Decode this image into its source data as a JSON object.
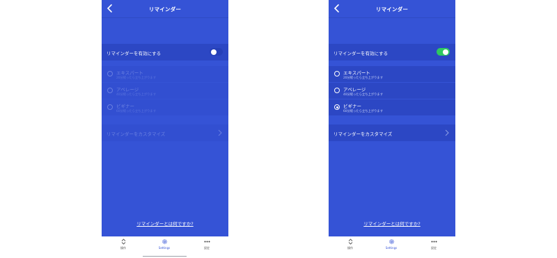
{
  "header": {
    "title": "リマインダー"
  },
  "toggle_row": {
    "label": "リマインダーを有効にする"
  },
  "options": [
    {
      "title": "エキスパート",
      "subtitle": "20分経ったら立ち上がります"
    },
    {
      "title": "アベレージ",
      "subtitle": "40分経ったら立ち上がります"
    },
    {
      "title": "ビギナー",
      "subtitle": "60分経ったら立ち上がります"
    }
  ],
  "customize": {
    "label": "リマインダーをカスタマイズ"
  },
  "help_link": "リマインダーとは何ですか?",
  "tabbar": {
    "tabs": [
      {
        "label": "操作",
        "icon": "sort-icon"
      },
      {
        "label": "Settings",
        "icon": "gear-icon"
      },
      {
        "label": "設定",
        "icon": "more-icon"
      }
    ]
  },
  "screens": [
    {
      "reminders_enabled": false,
      "selected_option": "ビギナー",
      "active_tab": "Settings"
    },
    {
      "reminders_enabled": true,
      "selected_option": "ビギナー",
      "active_tab": "Settings"
    }
  ],
  "colors": {
    "background": "#3553d6",
    "row": "#2c47c4",
    "toggle_on": "#2ec95f",
    "tabbar": "#ffffff"
  }
}
